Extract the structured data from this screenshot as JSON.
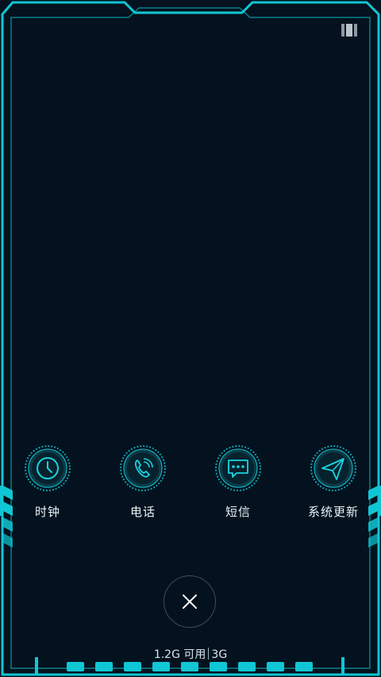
{
  "theme": {
    "accent": "#11c6d4",
    "background": "#03121e",
    "frame_dim": "#0a7f8c"
  },
  "status": {
    "recents_icon": "recent-apps-icon"
  },
  "apps": [
    {
      "label": "时钟",
      "icon": "clock-icon"
    },
    {
      "label": "电话",
      "icon": "phone-icon"
    },
    {
      "label": "短信",
      "icon": "message-icon"
    },
    {
      "label": "系统更新",
      "icon": "send-icon"
    }
  ],
  "close": {
    "icon": "close-icon"
  },
  "memory": {
    "available": "1.2G 可用",
    "total": "3G"
  }
}
